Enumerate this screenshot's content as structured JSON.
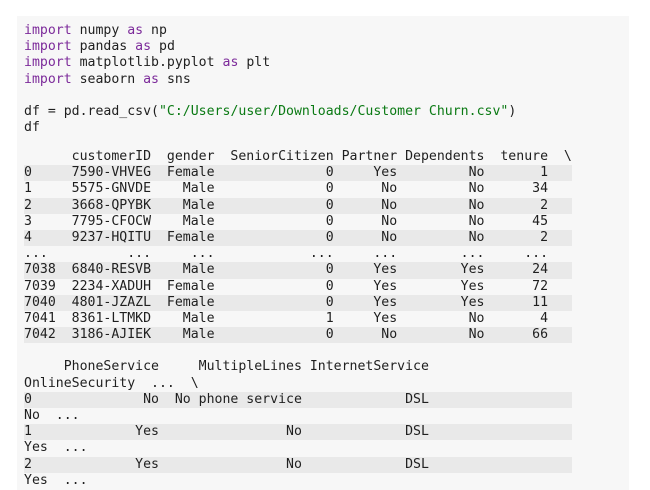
{
  "code": [
    [
      {
        "t": "import",
        "c": "kw"
      },
      {
        "t": " numpy "
      },
      {
        "t": "as",
        "c": "kw"
      },
      {
        "t": " np"
      }
    ],
    [
      {
        "t": "import",
        "c": "kw"
      },
      {
        "t": " pandas "
      },
      {
        "t": "as",
        "c": "kw"
      },
      {
        "t": " pd"
      }
    ],
    [
      {
        "t": "import",
        "c": "kw"
      },
      {
        "t": " matplotlib.pyplot "
      },
      {
        "t": "as",
        "c": "kw"
      },
      {
        "t": " plt"
      }
    ],
    [
      {
        "t": "import",
        "c": "kw"
      },
      {
        "t": " seaborn "
      },
      {
        "t": "as",
        "c": "kw"
      },
      {
        "t": " sns"
      }
    ],
    [],
    [
      {
        "t": "df = pd.read_csv("
      },
      {
        "t": "\"C:/Users/user/Downloads/Customer Churn.csv\"",
        "c": "str"
      },
      {
        "t": ")"
      }
    ],
    [
      {
        "t": "df"
      }
    ]
  ],
  "output": [
    "      customerID  gender  SeniorCitizen Partner Dependents  tenure  \\",
    "0     7590-VHVEG  Female              0     Yes         No       1",
    "1     5575-GNVDE    Male              0      No         No      34",
    "2     3668-QPYBK    Male              0      No         No       2",
    "3     7795-CFOCW    Male              0      No         No      45",
    "4     9237-HQITU  Female              0      No         No       2",
    "...          ...     ...            ...     ...        ...     ...",
    "7038  6840-RESVB    Male              0     Yes        Yes      24",
    "7039  2234-XADUH  Female              0     Yes        Yes      72",
    "7040  4801-JZAZL  Female              0     Yes        Yes      11",
    "7041  8361-LTMKD    Male              1     Yes         No       4",
    "7042  3186-AJIEK    Male              0      No         No      66",
    "",
    "     PhoneService     MultipleLines InternetService",
    "OnlineSecurity  ...  \\",
    "0              No  No phone service             DSL",
    "No  ...",
    "1             Yes                No             DSL",
    "Yes  ...",
    "2             Yes                No             DSL",
    "Yes  ..."
  ],
  "stripes": [
    1,
    3,
    5,
    7,
    9,
    11,
    15,
    17,
    19
  ]
}
